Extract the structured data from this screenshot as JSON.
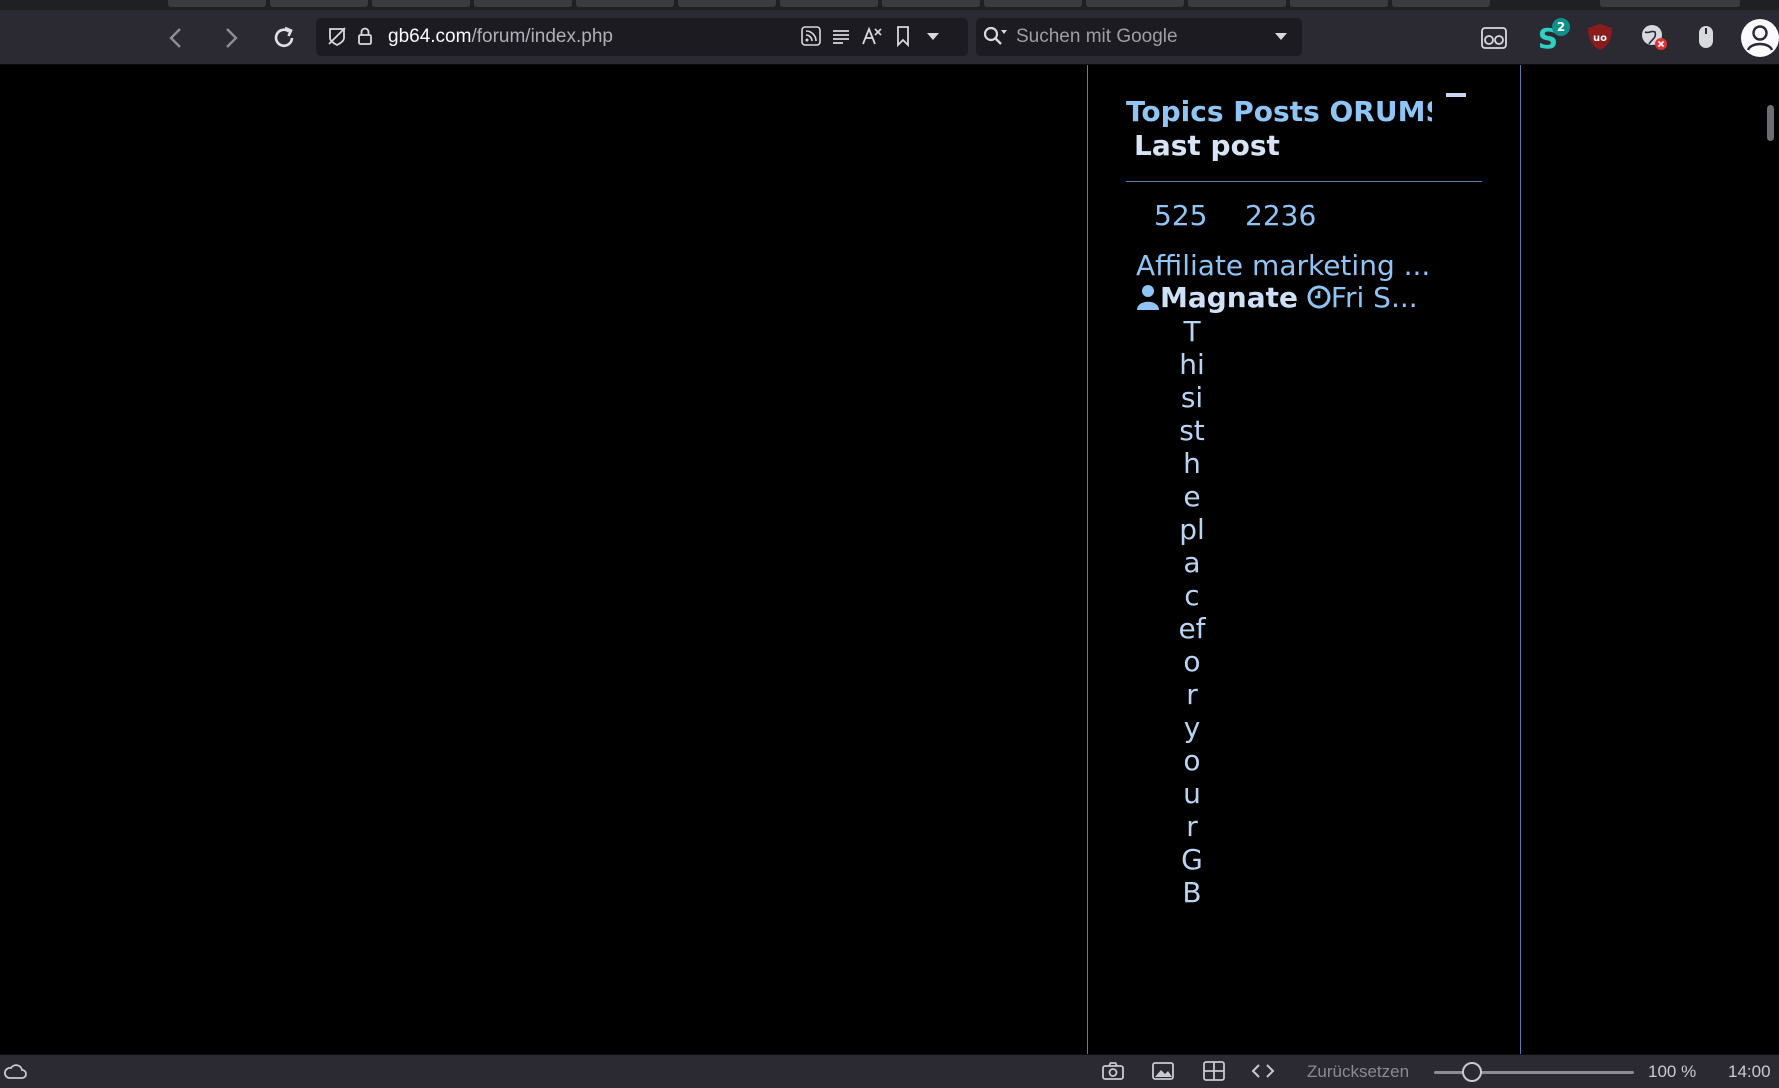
{
  "browser": {
    "url_host": "gb64.com",
    "url_path": "/forum/index.php",
    "search_placeholder": "Suchen mit Google",
    "extension_badge": "2"
  },
  "forum": {
    "header": {
      "columns": "Topics Posts ORUMS",
      "last_post": "Last post"
    },
    "row": {
      "topics": "525",
      "posts": "2236",
      "last_post_title": "Affiliate marketing ...",
      "last_post_user": "Magnate",
      "last_post_time": "Fri S...",
      "description": "Thisistheplaceforyour GB"
    }
  },
  "statusbar": {
    "reset_label": "Zurücksetzen",
    "zoom": "100 %",
    "clock": "14:00"
  },
  "icons": {
    "back": "chevron-left-icon",
    "forward": "chevron-right-icon",
    "reload": "reload-icon",
    "user": "user-icon",
    "clock": "clock-icon"
  }
}
